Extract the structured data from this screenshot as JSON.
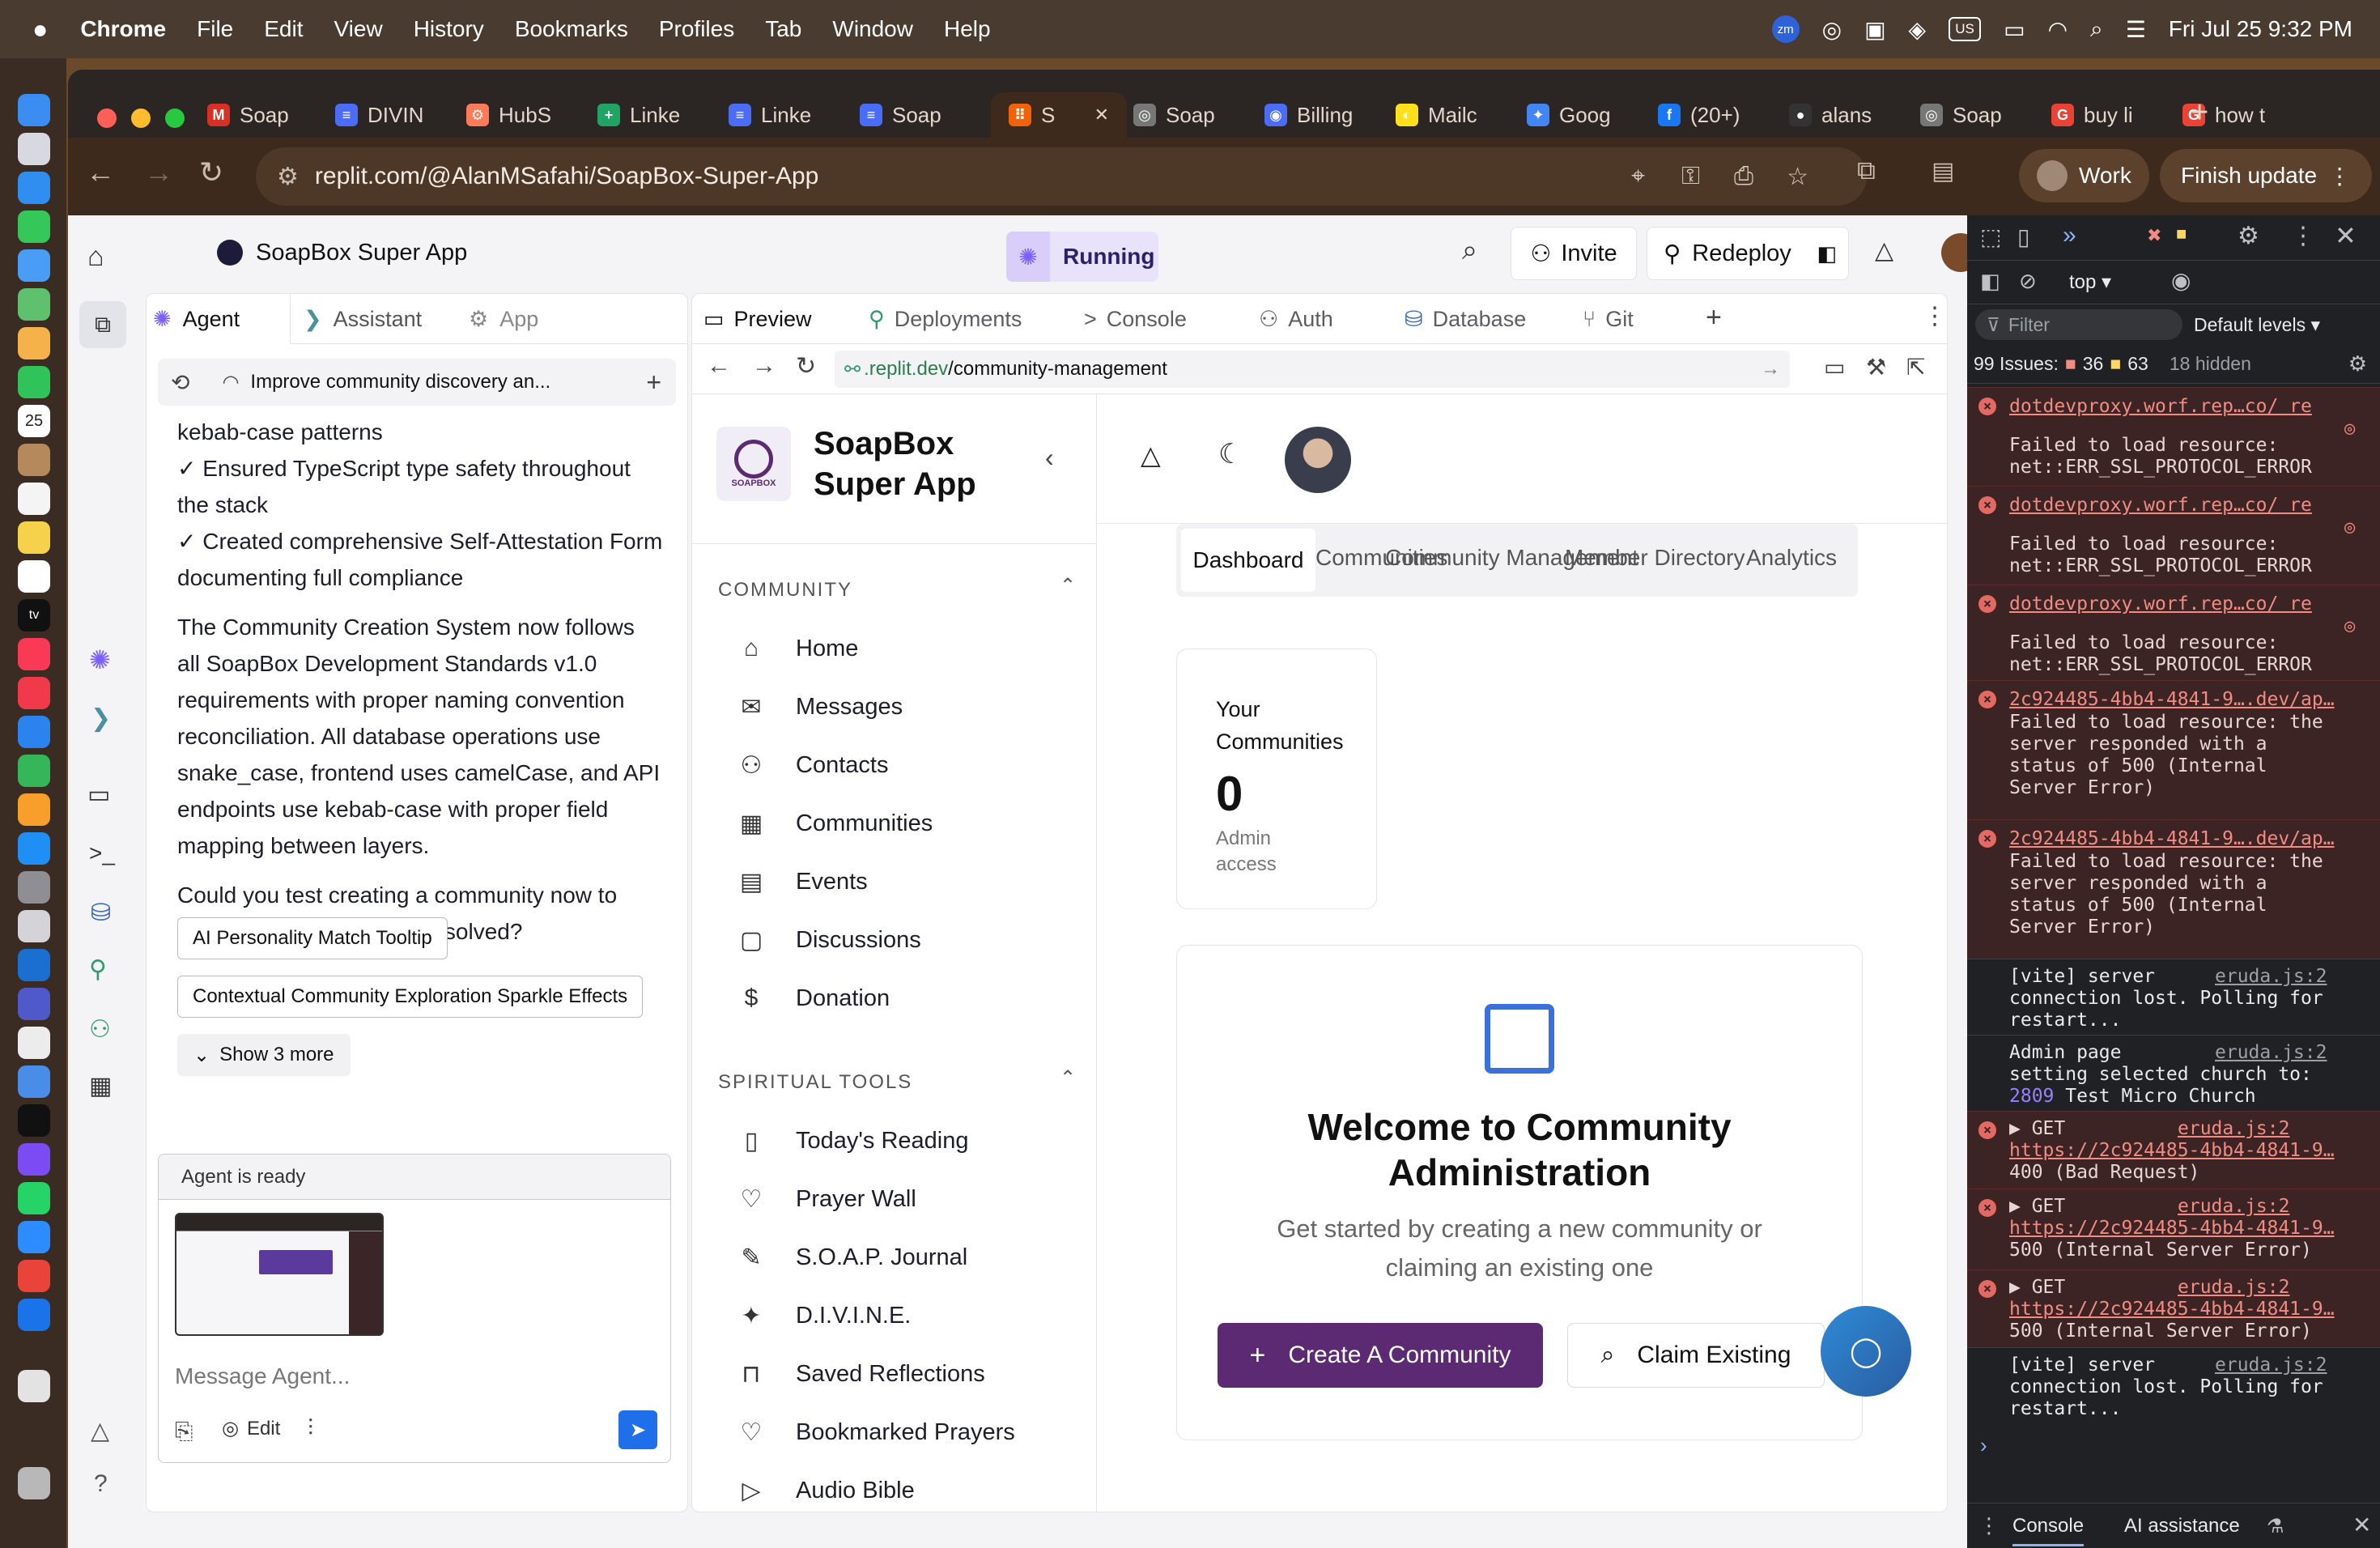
{
  "menubar": {
    "app": "Chrome",
    "items": [
      "File",
      "Edit",
      "View",
      "History",
      "Bookmarks",
      "Profiles",
      "Tab",
      "Window",
      "Help"
    ],
    "zm": "zm",
    "keyboard": "US",
    "datetime": "Fri Jul 25  9:32 PM"
  },
  "dock": {
    "calendar_day": "25",
    "tv": "tv"
  },
  "tabs": [
    {
      "label": "Soap",
      "fav": "M",
      "color": "#d93025"
    },
    {
      "label": "DIVIN",
      "fav": "≡",
      "color": "#4a6cf7"
    },
    {
      "label": "HubS",
      "fav": "⚙",
      "color": "#ff7a59"
    },
    {
      "label": "Linke",
      "fav": "+",
      "color": "#1fa463"
    },
    {
      "label": "Linke",
      "fav": "≡",
      "color": "#4a6cf7"
    },
    {
      "label": "Soap",
      "fav": "≡",
      "color": "#4a6cf7"
    },
    {
      "label": "S",
      "fav": "⠿",
      "color": "#f26207",
      "active": true
    },
    {
      "label": "Soap",
      "fav": "◎",
      "color": "#777"
    },
    {
      "label": "Billing",
      "fav": "◉",
      "color": "#4a6cf7"
    },
    {
      "label": "Mailc",
      "fav": "◐",
      "color": "#ffe01b"
    },
    {
      "label": "Goog",
      "fav": "✦",
      "color": "#4285f4"
    },
    {
      "label": "(20+)",
      "fav": "f",
      "color": "#1877f2"
    },
    {
      "label": "alans",
      "fav": "●",
      "color": "#333"
    },
    {
      "label": "Soap",
      "fav": "◎",
      "color": "#777"
    },
    {
      "label": "buy li",
      "fav": "G",
      "color": "#ea4335"
    },
    {
      "label": "how t",
      "fav": "G",
      "color": "#ea4335"
    }
  ],
  "omnibox": {
    "url": "replit.com/@AlanMSafahi/SoapBox-Super-App"
  },
  "profile": {
    "label": "Work"
  },
  "finish_update": "Finish update",
  "replit": {
    "project_title": "SoapBox Super App",
    "status": "Running",
    "invite": "Invite",
    "redeploy": "Redeploy"
  },
  "left_tabs": {
    "agent": "Agent",
    "assistant": "Assistant",
    "app": "App"
  },
  "agent": {
    "thread_title": "Improve community discovery an...",
    "messages": [
      "kebab-case patterns",
      "✓ Ensured TypeScript type safety throughout the stack",
      "✓ Created comprehensive Self-Attestation Form documenting full compliance",
      "The Community Creation System now follows all SoapBox Development Standards v1.0 requirements with proper naming convention reconciliation. All database operations use snake_case, frontend uses camelCase, and API endpoints use kebab-case with proper field mapping between layers.",
      "Could you test creating a community now to verify the 500 errors are resolved?"
    ],
    "suggestions": [
      "AI Personality Match Tooltip",
      "Contextual Community Exploration Sparkle Effects"
    ],
    "show_more": "Show 3 more",
    "status": "Agent is ready",
    "input_placeholder": "Message Agent...",
    "edit": "Edit"
  },
  "preview_tabs": [
    "Preview",
    "Deployments",
    "Console",
    "Auth",
    "Database",
    "Git"
  ],
  "preview_url": {
    "prefix": ".replit.dev",
    "path": "/community-management"
  },
  "app": {
    "brand_line1": "SoapBox",
    "brand_line2": "Super App",
    "logo_text": "SOAPBOX",
    "community_header": "COMMUNITY",
    "community_items": [
      "Home",
      "Messages",
      "Contacts",
      "Communities",
      "Events",
      "Discussions",
      "Donation"
    ],
    "tools_header": "SPIRITUAL TOOLS",
    "tools_items": [
      "Today's Reading",
      "Prayer Wall",
      "S.O.A.P. Journal",
      "D.I.V.I.N.E.",
      "Saved Reflections",
      "Bookmarked Prayers",
      "Audio Bible"
    ],
    "content_tabs": [
      "Dashboard",
      "Communities",
      "Community Management",
      "Member Directory",
      "Analytics"
    ],
    "card": {
      "label_line1": "Your",
      "label_line2": "Communities",
      "value": "0",
      "sub_line1": "Admin",
      "sub_line2": "access"
    },
    "welcome": {
      "title_line1": "Welcome to Community",
      "title_line2": "Administration",
      "sub_line1": "Get started by creating a new community or",
      "sub_line2": "claiming an existing one",
      "create": "Create A Community",
      "claim": "Claim Existing"
    }
  },
  "devtools": {
    "context": "top",
    "filter": "Filter",
    "levels": "Default levels ▾",
    "issues": "99 Issues:",
    "errors": "36",
    "warnings": "63",
    "hidden": "18 hidden",
    "entries": [
      {
        "type": "error",
        "source": "dotdevproxy.worf.rep…co/  re",
        "lines": [
          "Failed to load resource:",
          "net::ERR_SSL_PROTOCOL_ERROR"
        ]
      },
      {
        "type": "error",
        "source": "dotdevproxy.worf.rep…co/  re",
        "lines": [
          "Failed to load resource:",
          "net::ERR_SSL_PROTOCOL_ERROR"
        ]
      },
      {
        "type": "error",
        "source": "dotdevproxy.worf.rep…co/  re",
        "lines": [
          "Failed to load resource:",
          "net::ERR_SSL_PROTOCOL_ERROR"
        ]
      },
      {
        "type": "error",
        "source": "2c924485-4bb4-4841-9….dev/ap…",
        "lines": [
          "Failed to load resource: the",
          "server responded with a",
          "status of 500 (Internal",
          "Server Error)"
        ]
      },
      {
        "type": "error",
        "source": "2c924485-4bb4-4841-9….dev/ap…",
        "lines": [
          "Failed to load resource: the",
          "server responded with a",
          "status of 500 (Internal",
          "Server Error)"
        ]
      }
    ],
    "vite1": [
      "[vite] server",
      "connection lost. Polling for",
      "restart..."
    ],
    "eruda": "eruda.js:2",
    "admin": [
      "Admin page",
      "setting selected church to:"
    ],
    "admin_num": "2809",
    "admin_church": " Test Micro Church",
    "gets": [
      {
        "url": "https://2c924485-4bb4-4841-9…",
        "status": "400 (Bad Request)"
      },
      {
        "url": "https://2c924485-4bb4-4841-9…",
        "status": "500 (Internal Server Error)"
      },
      {
        "url": "https://2c924485-4bb4-4841-9…",
        "status": "500 (Internal Server Error)"
      }
    ],
    "get": "▶ GET",
    "vite2": [
      "[vite] server",
      "connection lost. Polling for",
      "restart..."
    ],
    "bottom_console": "Console",
    "bottom_ai": "AI assistance"
  }
}
